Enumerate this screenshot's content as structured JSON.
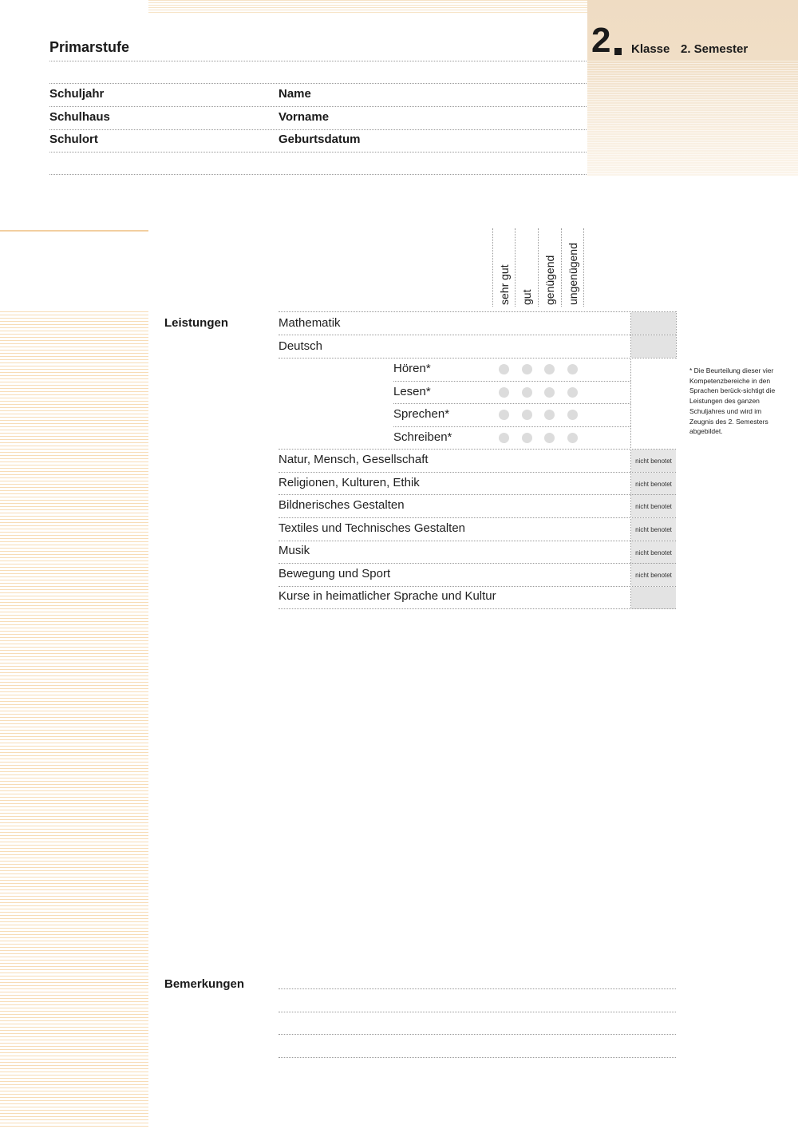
{
  "header": {
    "stage": "Primarstufe",
    "grade_number": "2",
    "class_label": "Klasse",
    "semester_label": "2. Semester"
  },
  "fields": {
    "school_year": "Schuljahr",
    "school_house": "Schulhaus",
    "school_place": "Schulort",
    "name": "Name",
    "first_name": "Vorname",
    "birth_date": "Geburtsdatum"
  },
  "grade_scale": [
    "sehr gut",
    "gut",
    "genügend",
    "ungenügend"
  ],
  "performance": {
    "label": "Leistungen",
    "subjects_top": [
      "Mathematik",
      "Deutsch"
    ],
    "competences": [
      "Hören*",
      "Lesen*",
      "Sprechen*",
      "Schreiben*"
    ],
    "subjects_ungraded": [
      "Natur, Mensch, Gesellschaft",
      "Religionen, Kulturen, Ethik",
      "Bildnerisches Gestalten",
      "Textiles und Technisches Gestalten",
      "Musik",
      "Bewegung und Sport"
    ],
    "not_graded_label": "nicht benotet",
    "last_subject": "Kurse in heimatlicher Sprache und Kultur"
  },
  "footnote": "* Die Beurteilung dieser vier Kompetenzbereiche in den Sprachen berück-sichtigt die Leistungen des ganzen Schuljahres und wird im Zeugnis des 2. Semesters abgebildet.",
  "remarks": {
    "label": "Bemerkungen"
  },
  "colors": {
    "accent_beige": "#efdcc3",
    "stripe_orange": "#f7dcb6",
    "grade_box_grey": "#e3e3e3",
    "circle_grey": "#dcdcdc"
  }
}
